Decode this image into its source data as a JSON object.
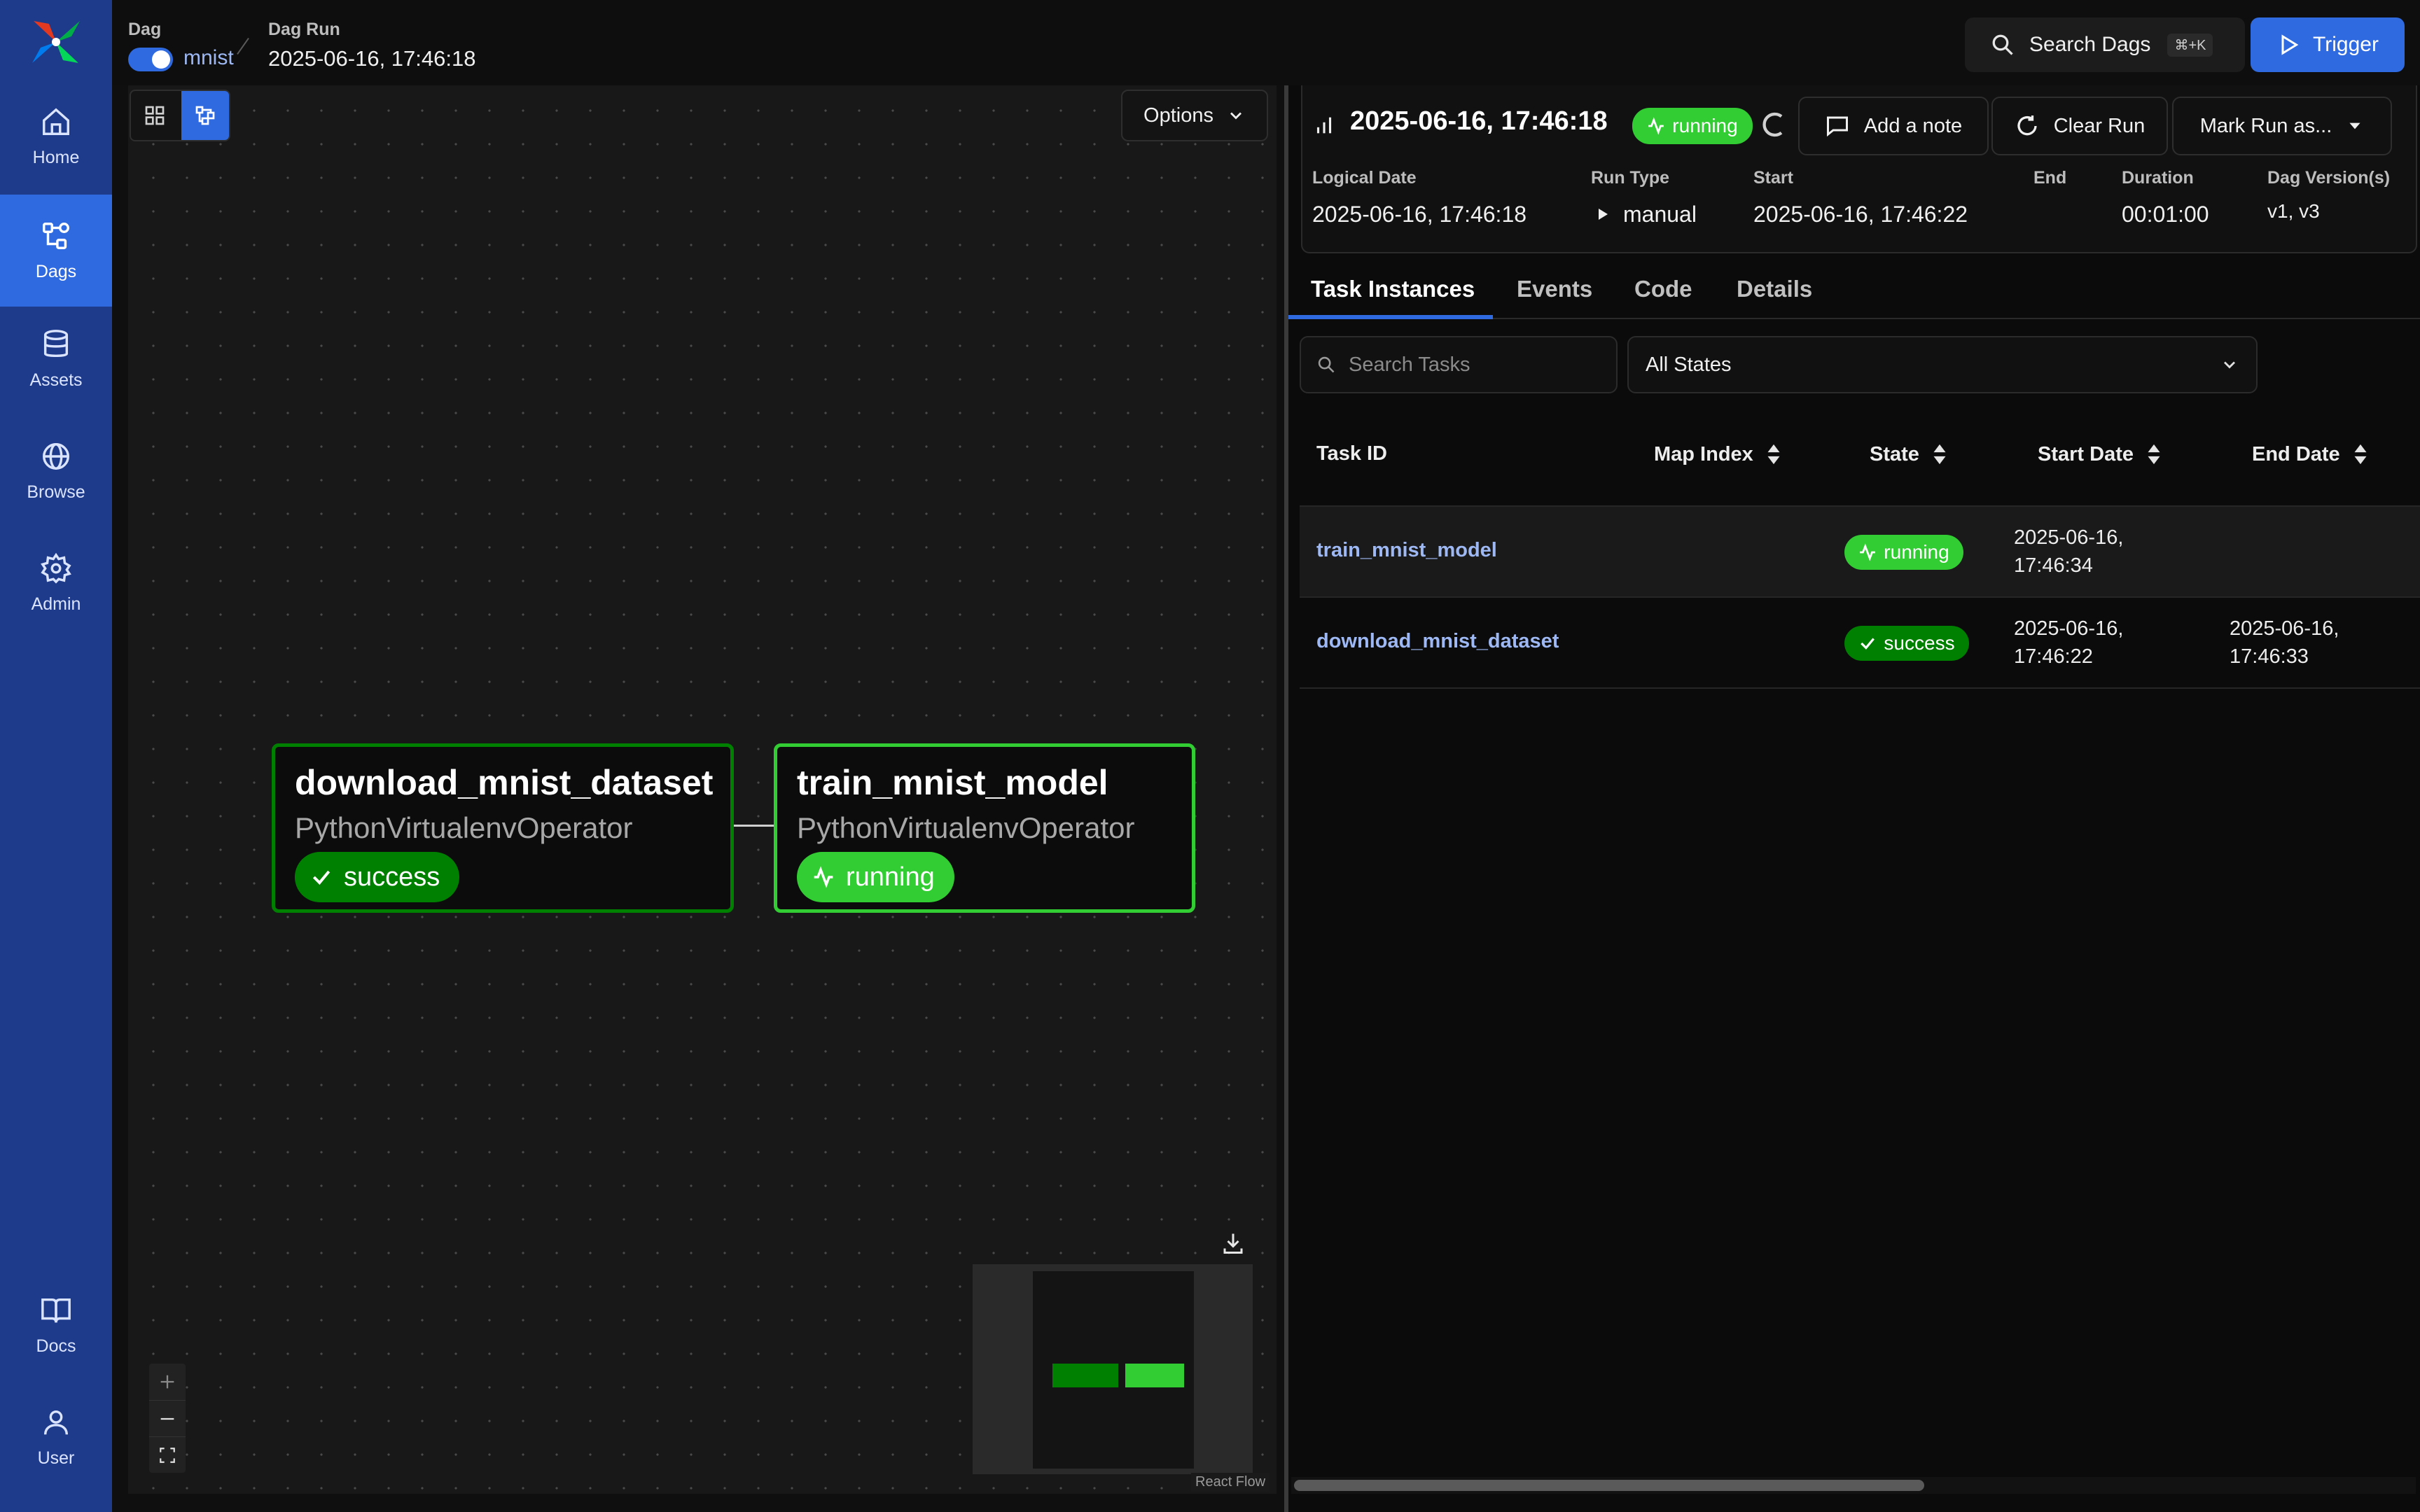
{
  "sidebar": {
    "items": [
      {
        "label": "Home",
        "icon": "home-icon"
      },
      {
        "label": "Dags",
        "icon": "dags-icon"
      },
      {
        "label": "Assets",
        "icon": "database-icon"
      },
      {
        "label": "Browse",
        "icon": "globe-icon"
      },
      {
        "label": "Admin",
        "icon": "gear-icon"
      },
      {
        "label": "Docs",
        "icon": "book-icon"
      },
      {
        "label": "User",
        "icon": "user-icon"
      }
    ],
    "active": "Dags"
  },
  "breadcrumb": {
    "dag_label": "Dag",
    "dag_name": "mnist",
    "run_label": "Dag Run",
    "run_value": "2025-06-16, 17:46:18"
  },
  "header": {
    "search_label": "Search Dags",
    "search_shortcut": "⌘+K",
    "trigger_label": "Trigger"
  },
  "graph": {
    "options_label": "Options",
    "nodes": [
      {
        "title": "download_mnist_dataset",
        "operator": "PythonVirtualenvOperator",
        "state": "success"
      },
      {
        "title": "train_mnist_model",
        "operator": "PythonVirtualenvOperator",
        "state": "running"
      }
    ],
    "attribution": "React Flow"
  },
  "run": {
    "title": "2025-06-16, 17:46:18",
    "state": "running",
    "add_note": "Add a note",
    "clear_run": "Clear Run",
    "mark_run": "Mark Run as...",
    "details": {
      "logical_date_label": "Logical Date",
      "logical_date": "2025-06-16, 17:46:18",
      "run_type_label": "Run Type",
      "run_type": "manual",
      "start_label": "Start",
      "start": "2025-06-16, 17:46:22",
      "end_label": "End",
      "duration_label": "Duration",
      "duration": "00:01:00",
      "version_label": "Dag Version(s)",
      "version": "v1, v3"
    }
  },
  "tabs": [
    "Task Instances",
    "Events",
    "Code",
    "Details"
  ],
  "filters": {
    "search_placeholder": "Search Tasks",
    "state_select": "All States"
  },
  "table": {
    "headers": [
      "Task ID",
      "Map Index",
      "State",
      "Start Date",
      "End Date"
    ],
    "rows": [
      {
        "task_id": "train_mnist_model",
        "map_index": "",
        "state": "running",
        "start_1": "2025-06-16,",
        "start_2": "17:46:34",
        "end_1": "",
        "end_2": ""
      },
      {
        "task_id": "download_mnist_dataset",
        "map_index": "",
        "state": "success",
        "start_1": "2025-06-16,",
        "start_2": "17:46:22",
        "end_1": "2025-06-16,",
        "end_2": "17:46:33"
      }
    ]
  },
  "colors": {
    "success": "#008000",
    "running": "#32cd32",
    "accent": "#2f6ae0"
  }
}
